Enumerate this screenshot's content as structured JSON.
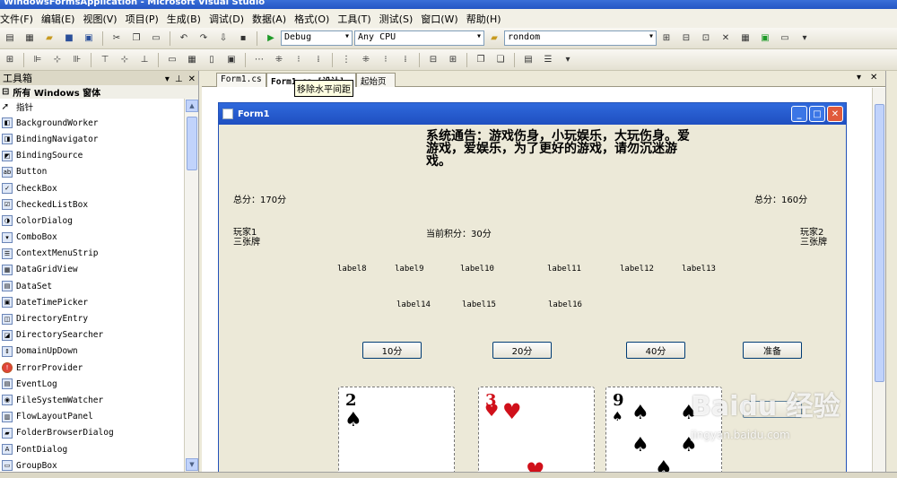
{
  "window": {
    "title": "WindowsFormsApplication - Microsoft Visual Studio"
  },
  "menu": [
    "文件(F)",
    "编辑(E)",
    "视图(V)",
    "项目(P)",
    "生成(B)",
    "调试(D)",
    "数据(A)",
    "格式(O)",
    "工具(T)",
    "测试(S)",
    "窗口(W)",
    "帮助(H)"
  ],
  "toolbar": {
    "config": "Debug",
    "platform": "Any CPU",
    "search": "rondom"
  },
  "toolbox": {
    "title": "工具箱",
    "section": "所有 Windows 窗体",
    "items": [
      "指针",
      "BackgroundWorker",
      "BindingNavigator",
      "BindingSource",
      "Button",
      "CheckBox",
      "CheckedListBox",
      "ColorDialog",
      "ComboBox",
      "ContextMenuStrip",
      "DataGridView",
      "DataSet",
      "DateTimePicker",
      "DirectoryEntry",
      "DirectorySearcher",
      "DomainUpDown",
      "ErrorProvider",
      "EventLog",
      "FileSystemWatcher",
      "FlowLayoutPanel",
      "FolderBrowserDialog",
      "FontDialog",
      "GroupBox"
    ]
  },
  "tabs": [
    "Form1.cs",
    "Form1.cs [设计]",
    "起始页"
  ],
  "tooltip": "移除水平间距",
  "form": {
    "title": "Form1",
    "notice": "系统通告：游戏伤身，小玩娱乐，大玩伤身。爱游戏，爱娱乐，为了更好的游戏，请勿沉迷游戏。",
    "total_left": "总分：170分",
    "total_right": "总分：160分",
    "current_score": "当前积分：30分",
    "player1_name": "玩家1",
    "player1_cards": "三张牌",
    "player2_name": "玩家2",
    "player2_cards": "三张牌",
    "labels_row1": [
      "label8",
      "label9",
      "label10",
      "label11",
      "label12",
      "label13"
    ],
    "labels_row2": [
      "label14",
      "label15",
      "label16"
    ],
    "buttons": [
      "10分",
      "20分",
      "40分",
      "准备"
    ],
    "cards": [
      {
        "rank": "2",
        "suit": "♠",
        "color": "#000000"
      },
      {
        "rank": "3",
        "suit": "♥",
        "color": "#d0101a"
      },
      {
        "rank": "9",
        "suit": "♠",
        "color": "#000000"
      }
    ]
  },
  "watermark": {
    "text": "Baidu 经验",
    "url": "jingyan.baidu.com"
  }
}
